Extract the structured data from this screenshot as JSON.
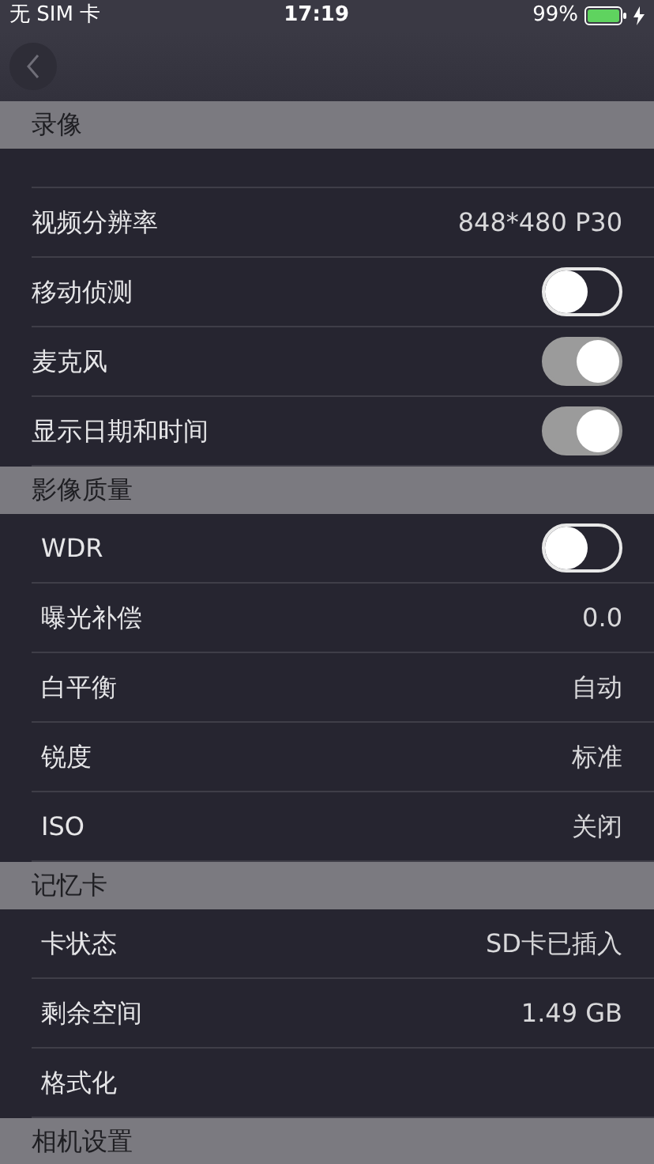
{
  "status_bar": {
    "carrier": "无 SIM 卡",
    "time": "17:19",
    "battery": "99%"
  },
  "sections": [
    {
      "title": "录像",
      "rows": [
        {
          "label": "视频分辨率",
          "kind": "value",
          "value": "848*480 P30"
        },
        {
          "label": "移动侦测",
          "kind": "toggle",
          "on": false
        },
        {
          "label": "麦克风",
          "kind": "toggle",
          "on": true
        },
        {
          "label": "显示日期和时间",
          "kind": "toggle",
          "on": true
        }
      ]
    },
    {
      "title": "影像质量",
      "rows": [
        {
          "label": "WDR",
          "kind": "toggle",
          "on": false
        },
        {
          "label": "曝光补偿",
          "kind": "value",
          "value": "0.0"
        },
        {
          "label": "白平衡",
          "kind": "value",
          "value": "自动"
        },
        {
          "label": "锐度",
          "kind": "value",
          "value": "标准"
        },
        {
          "label": "ISO",
          "kind": "value",
          "value": "关闭"
        }
      ]
    },
    {
      "title": "记忆卡",
      "rows": [
        {
          "label": "卡状态",
          "kind": "value",
          "value": "SD卡已插入"
        },
        {
          "label": "剩余空间",
          "kind": "value",
          "value": "1.49 GB"
        },
        {
          "label": "格式化",
          "kind": "action"
        }
      ]
    },
    {
      "title": "相机设置"
    }
  ]
}
